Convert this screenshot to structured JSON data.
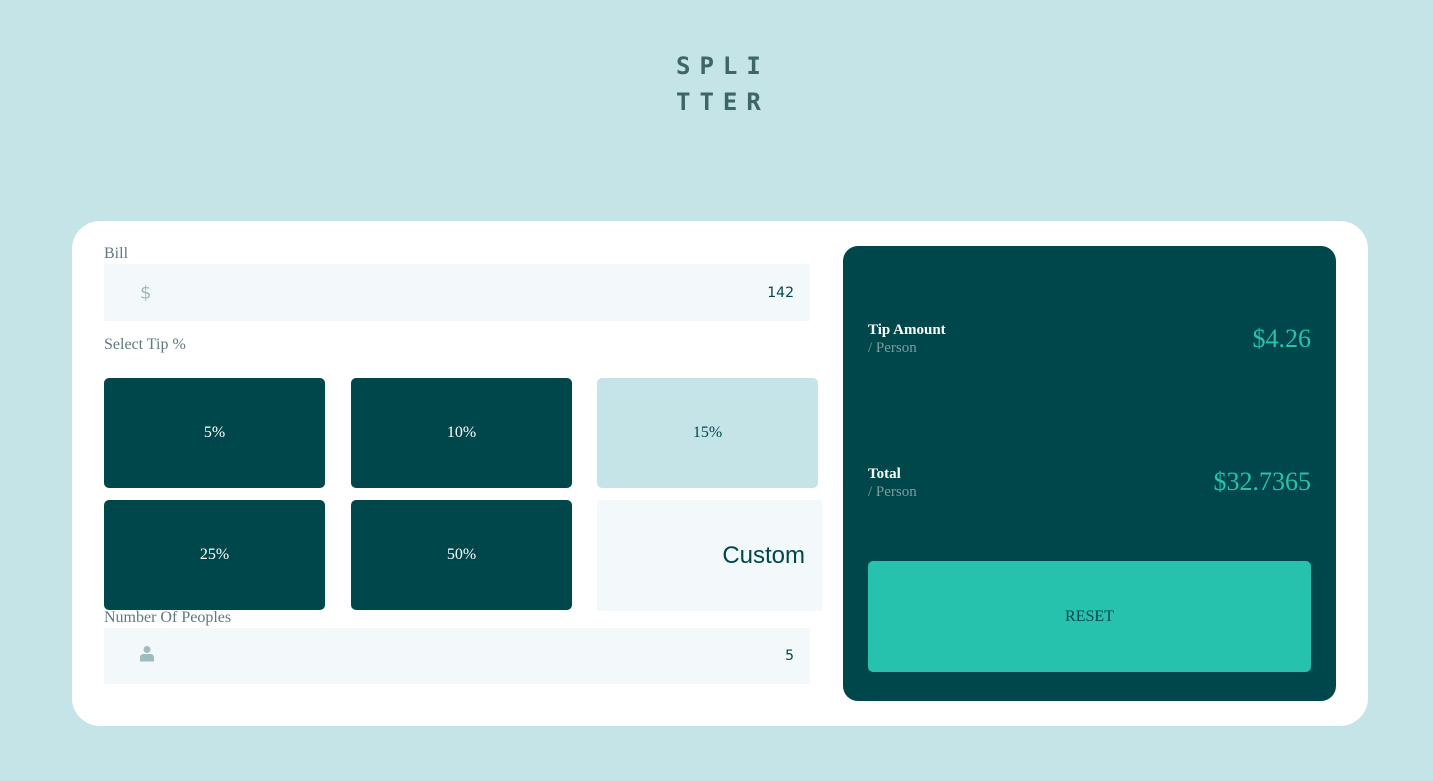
{
  "logo": {
    "line1": "SPLI",
    "line2": "TTER"
  },
  "bill": {
    "label": "Bill",
    "icon": "dollar-icon",
    "icon_glyph": "$",
    "value": "142"
  },
  "tip": {
    "label": "Select Tip %",
    "options": [
      "5%",
      "10%",
      "15%",
      "25%",
      "50%"
    ],
    "selected": "15%",
    "custom_label": "Custom"
  },
  "people": {
    "label": "Number Of Peoples",
    "icon": "person-icon",
    "value": "5"
  },
  "result": {
    "tip_title": "Tip Amount",
    "tip_sub": "/ Person",
    "tip_value": "$4.26",
    "total_title": "Total",
    "total_sub": "/ Person",
    "total_value": "$32.7365",
    "reset_label": "RESET"
  },
  "colors": {
    "background": "#c5e4e7",
    "dark_cyan": "#00474b",
    "accent": "#26c2ae",
    "field_bg": "#f3f9fa"
  }
}
